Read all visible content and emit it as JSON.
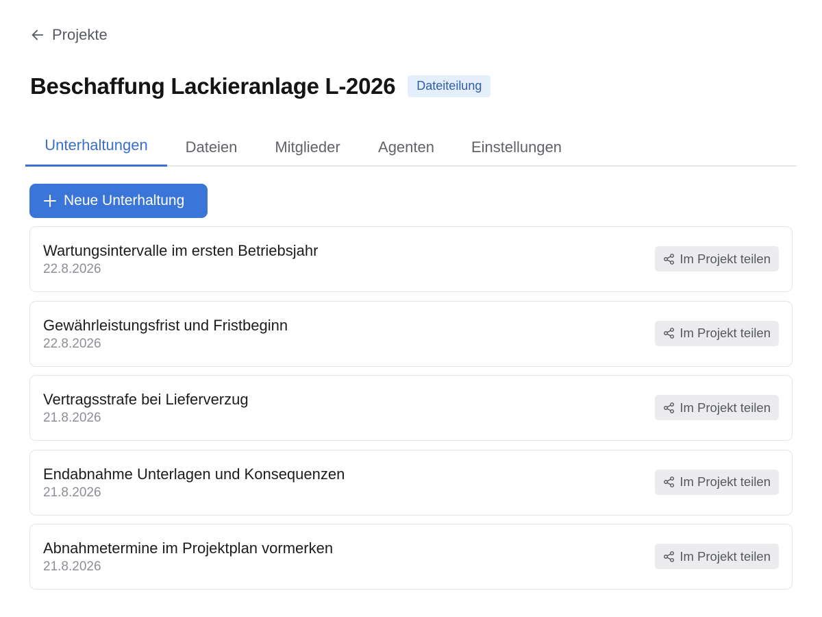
{
  "nav": {
    "back_label": "Projekte",
    "back_icon": "arrow-left-icon"
  },
  "project": {
    "title": "Beschaffung Lackieranlage L-2026",
    "badge": "Dateiteilung"
  },
  "tabs": [
    {
      "label": "Unterhaltungen",
      "active": true
    },
    {
      "label": "Dateien",
      "active": false
    },
    {
      "label": "Mitglieder",
      "active": false
    },
    {
      "label": "Agenten",
      "active": false
    },
    {
      "label": "Einstellungen",
      "active": false
    }
  ],
  "actions": {
    "new_conversation_label": "Neue Unterhaltung",
    "new_conversation_icon": "plus-icon"
  },
  "conversations": [
    {
      "title": "Wartungsintervalle im ersten Betriebsjahr",
      "date": "22.8.2026",
      "share_label": "Im Projekt teilen"
    },
    {
      "title": "Gewährleistungsfrist und Fristbeginn",
      "date": "22.8.2026",
      "share_label": "Im Projekt teilen"
    },
    {
      "title": "Vertragsstrafe bei Lieferverzug",
      "date": "21.8.2026",
      "share_label": "Im Projekt teilen"
    },
    {
      "title": "Endabnahme Unterlagen und Konsequenzen",
      "date": "21.8.2026",
      "share_label": "Im Projekt teilen"
    },
    {
      "title": "Abnahmetermine im Projektplan vormerken",
      "date": "21.8.2026",
      "share_label": "Im Projekt teilen"
    }
  ],
  "colors": {
    "accent": "#3a75d8",
    "tab_active": "#3a6fcf",
    "badge_bg": "#e5eefb",
    "badge_text": "#2f5ea8",
    "share_bg": "#ececee",
    "border": "#e3e4e6"
  }
}
